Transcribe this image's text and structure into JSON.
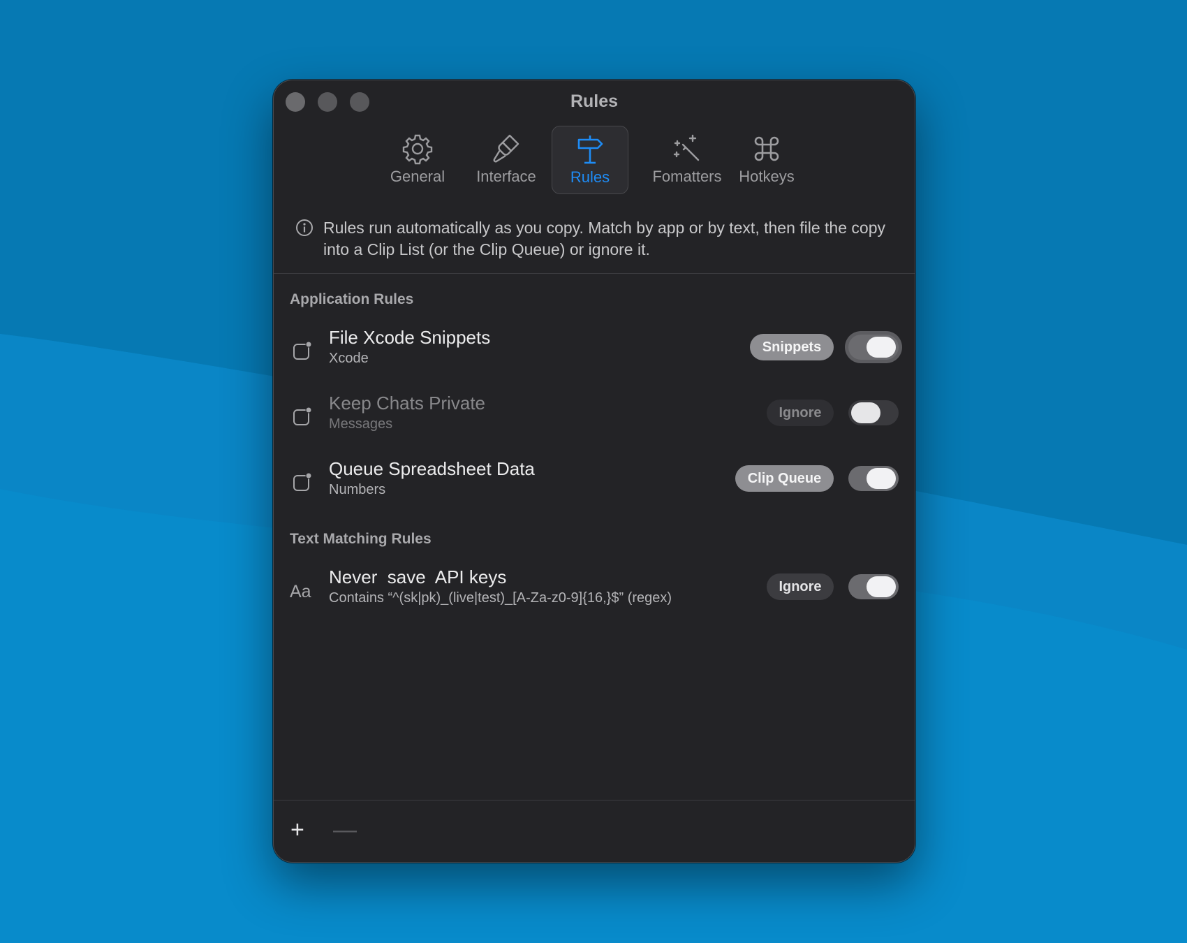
{
  "window": {
    "title": "Rules"
  },
  "tabs": [
    {
      "label": "General",
      "icon": "gear-icon"
    },
    {
      "label": "Interface",
      "icon": "paintbrush-icon"
    },
    {
      "label": "Rules",
      "icon": "signpost-icon",
      "active": true
    },
    {
      "label": "Fomatters",
      "icon": "magic-wand-icon"
    },
    {
      "label": "Hotkeys",
      "icon": "command-icon"
    }
  ],
  "info": {
    "text": "Rules run automatically as you copy. Match by app or by text, then file the copy into a Clip List (or the Clip Queue) or ignore it."
  },
  "application_rules": {
    "heading": "Application Rules",
    "rows": [
      {
        "name": "File Xcode Snippets",
        "app": "Xcode",
        "destination": "Snippets",
        "enabled": true
      },
      {
        "name": "Keep Chats Private",
        "app": "Messages",
        "destination": "Ignore",
        "enabled": false
      },
      {
        "name": "Queue Spreadsheet Data",
        "app": "Numbers",
        "destination": "Clip Queue",
        "enabled": true
      }
    ]
  },
  "text_rules": {
    "heading": "Text Matching Rules",
    "rows": [
      {
        "icon_text": "Aa",
        "name": "Never  save  API keys",
        "condition": "Contains “^(sk|pk)_(live|test)_[A-Za-z0-9]{16,}$” (regex)",
        "destination": "Ignore",
        "enabled": true
      }
    ]
  },
  "footer": {
    "add_label": "+",
    "remove_label": "—"
  },
  "colors": {
    "accent": "#1e8cf6",
    "window_bg": "#232326",
    "wallpaper": "#0a87c4"
  }
}
